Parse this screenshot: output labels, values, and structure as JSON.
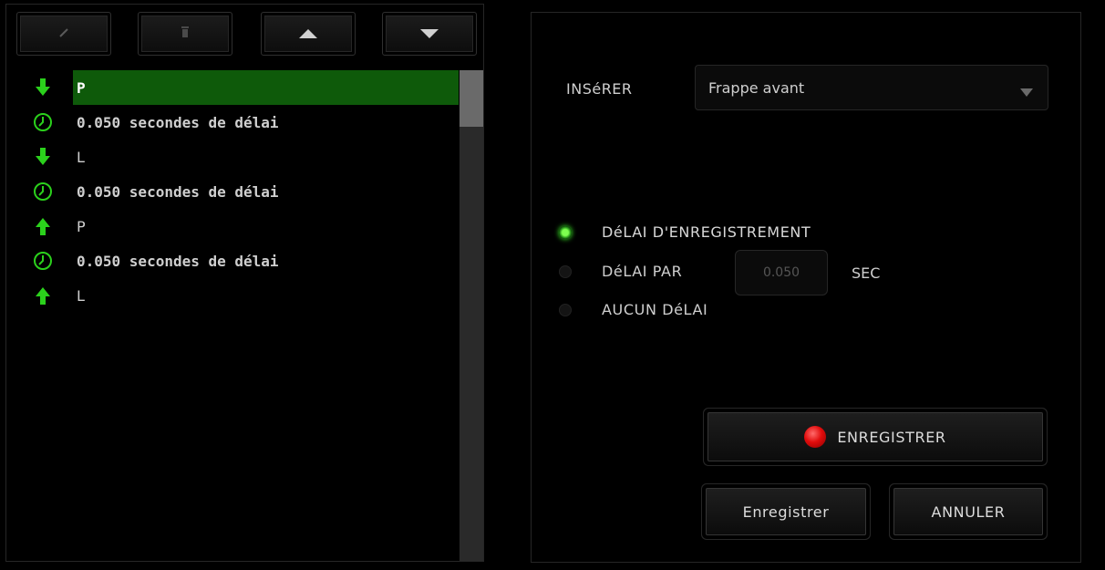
{
  "toolbar": {
    "buttons": [
      {
        "icon": "edit-icon"
      },
      {
        "icon": "trash-icon"
      },
      {
        "icon": "arrow-up-icon"
      },
      {
        "icon": "arrow-down-icon"
      }
    ]
  },
  "macro_list": {
    "rows": [
      {
        "icon": "key-down-icon",
        "label": "P",
        "selected": true
      },
      {
        "icon": "clock-icon",
        "label": "0.050 secondes de délai"
      },
      {
        "icon": "key-down-icon",
        "label": "L"
      },
      {
        "icon": "clock-icon",
        "label": "0.050 secondes de délai"
      },
      {
        "icon": "key-up-icon",
        "label": "P"
      },
      {
        "icon": "clock-icon",
        "label": "0.050 secondes de délai"
      },
      {
        "icon": "key-up-icon",
        "label": "L"
      }
    ]
  },
  "insert": {
    "label": "INSéRER",
    "selected": "Frappe avant"
  },
  "delay_options": {
    "record_delay": "DéLAI D'ENREGISTREMENT",
    "delay_per": "DéLAI PAR",
    "no_delay": "AUCUN DéLAI",
    "delay_value": "0.050",
    "sec_label": "SEC",
    "selected": "record_delay"
  },
  "buttons": {
    "record": "ENREGISTRER",
    "save": "Enregistrer",
    "cancel": "ANNULER"
  },
  "colors": {
    "accent_green": "#2bd11c",
    "selection": "#0e5a0a",
    "record_red": "#e10c0c"
  }
}
